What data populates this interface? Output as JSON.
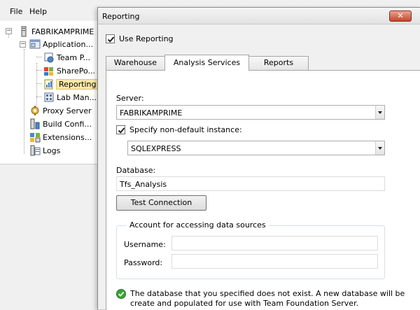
{
  "menu": {
    "file": "File",
    "help": "Help"
  },
  "tree": {
    "root": "FABRIKAMPRIME",
    "application_tier": "Application...",
    "team_project": "Team P...",
    "sharepoint": "SharePo...",
    "reporting": "Reporting",
    "lab_management": "Lab Man...",
    "proxy_server": "Proxy Server",
    "build_configuration": "Build Confi...",
    "extensions": "Extensions...",
    "logs": "Logs"
  },
  "dialog": {
    "title": "Reporting",
    "close_glyph": "✕",
    "use_reporting_label": "Use Reporting",
    "use_reporting_checked": true,
    "tabs": [
      "Warehouse",
      "Analysis Services",
      "Reports"
    ],
    "active_tab": "Analysis Services",
    "server_label": "Server:",
    "server_value": "FABRIKAMPRIME",
    "specify_instance_label": "Specify non-default instance:",
    "specify_instance_checked": true,
    "instance_value": "SQLEXPRESS",
    "database_label": "Database:",
    "database_value": "Tfs_Analysis",
    "test_connection_label": "Test Connection",
    "account_group_label": "Account for accessing data sources",
    "username_label": "Username:",
    "username_value": "",
    "password_label": "Password:",
    "password_value": "",
    "status_line1": "The database that you specified does not exist. A new database will be",
    "status_line2": "create and populated for use with Team Foundation Server."
  },
  "colors": {
    "selection": "#fbe9a8",
    "close_button": "#c7442b",
    "status_ok": "#3aa335"
  }
}
